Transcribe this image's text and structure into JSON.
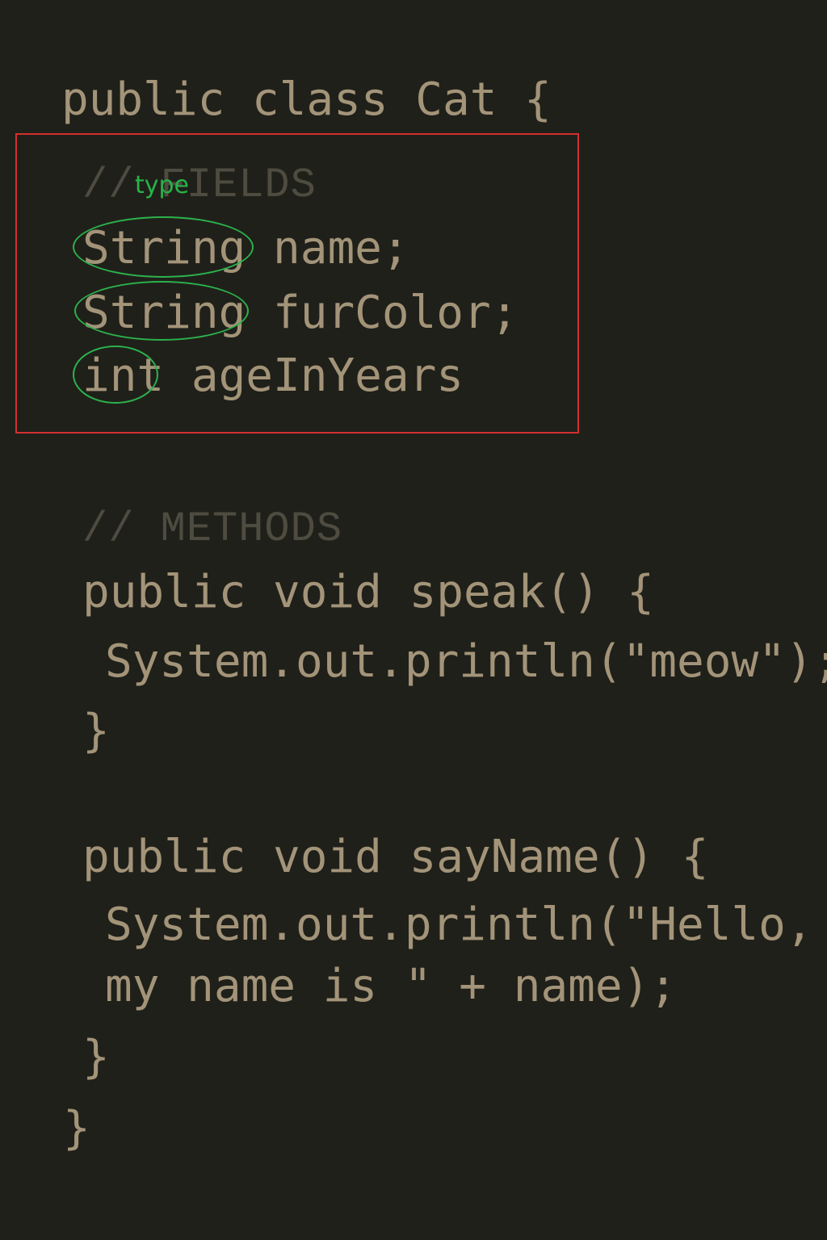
{
  "code": {
    "class_open": "public class Cat {",
    "fields_comment": "// FIELDS",
    "field_name_type": "String",
    "field_name_rest": " name;",
    "field_fur_type": "String",
    "field_fur_rest": " furColor;",
    "field_age_type": "int",
    "field_age_rest": " ageInYears",
    "methods_comment": "// METHODS",
    "speak_sig": "public void speak() {",
    "speak_body": "System.out.println(\"meow\");",
    "speak_close": "}",
    "sayname_sig": "public void sayName() {",
    "sayname_body_1": "System.out.println(\"Hello,",
    "sayname_body_2": "my name is \" + name);",
    "sayname_close": "}",
    "class_close": "}"
  },
  "annotations": {
    "type_label": "type",
    "box_color": "#d32f2f",
    "oval_color": "#2bb24c"
  },
  "colors": {
    "background": "#20201a",
    "code_text": "#a39479",
    "comment_text": "#4e4c40"
  }
}
